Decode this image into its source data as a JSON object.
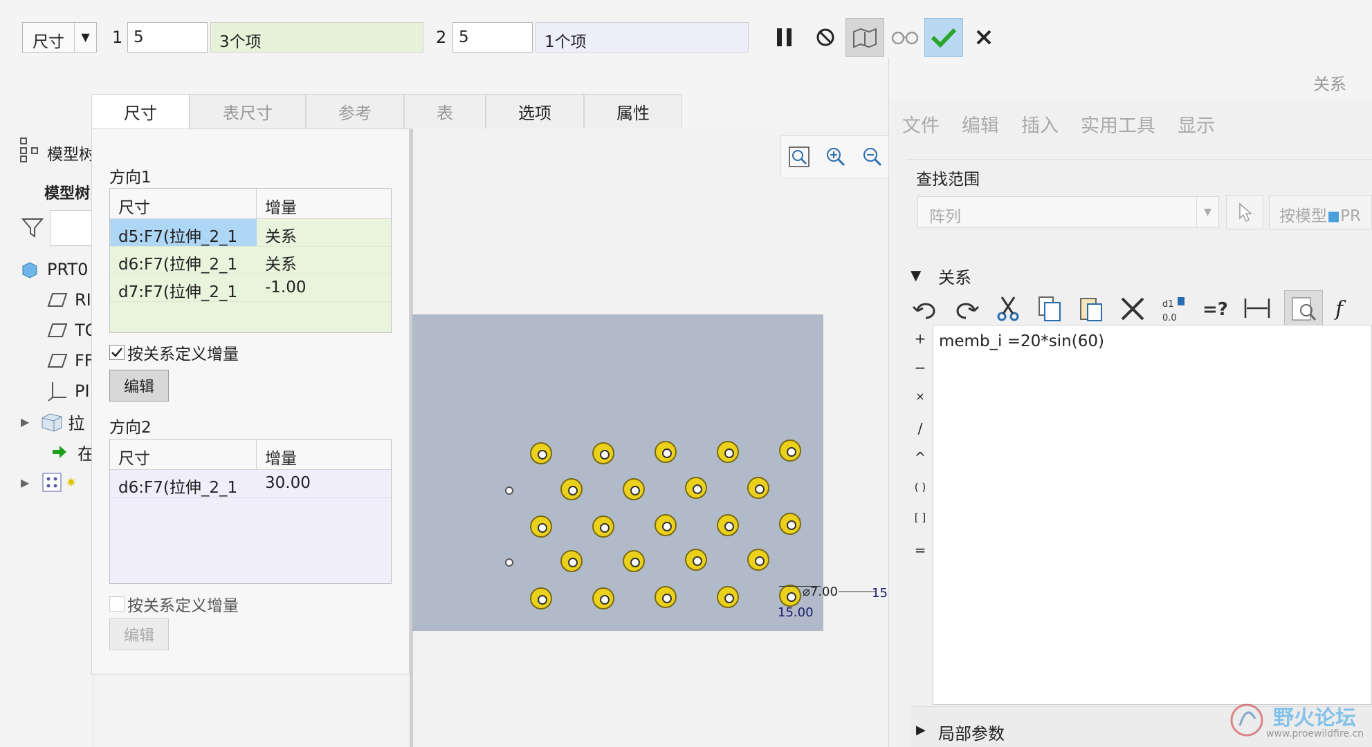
{
  "toolbar": {
    "combo_value": "尺寸",
    "dir1_label": "1",
    "dir1_count": "5",
    "dir1_items": "3个项",
    "dir2_label": "2",
    "dir2_count": "5",
    "dir2_items": "1个项",
    "buttons": [
      "pause-icon",
      "stop-icon",
      "preview-icon",
      "glasses-icon",
      "ok-icon",
      "cancel-icon"
    ]
  },
  "tabs": [
    "尺寸",
    "表尺寸",
    "参考",
    "表",
    "选项",
    "属性"
  ],
  "model_tree": {
    "title": "模型树",
    "header": "模型树",
    "items": [
      "PRT0",
      "RI",
      "TO",
      "FF",
      "PI",
      "拉",
      "在"
    ]
  },
  "direction1": {
    "title": "方向1",
    "col_dim": "尺寸",
    "col_inc": "增量",
    "rows": [
      {
        "dim": "d5:F7(拉伸_2_1",
        "inc": "关系"
      },
      {
        "dim": "d6:F7(拉伸_2_1",
        "inc": "关系"
      },
      {
        "dim": "d7:F7(拉伸_2_1",
        "inc": "-1.00"
      }
    ],
    "checkbox_label": "按关系定义增量",
    "checked": true,
    "edit_label": "编辑"
  },
  "direction2": {
    "title": "方向2",
    "col_dim": "尺寸",
    "col_inc": "增量",
    "rows": [
      {
        "dim": "d6:F7(拉伸_2_1",
        "inc": "30.00"
      }
    ],
    "checkbox_label": "按关系定义增量",
    "checked": false,
    "edit_label": "编辑"
  },
  "canvas": {
    "dim_dia": "⌀7.00",
    "dim_h": "15.00",
    "dim_side": "15"
  },
  "relations": {
    "title": "关系",
    "menu": [
      "文件",
      "编辑",
      "插入",
      "实用工具",
      "显示"
    ],
    "scope_label": "查找范围",
    "scope_value": "阵列",
    "by_model": "按模型",
    "by_model_suffix": "PR",
    "section_label": "关系",
    "code": "memb_i =20*sin(60)",
    "operators": [
      "+",
      "−",
      "×",
      "/",
      "^",
      "( )",
      "[ ]",
      "="
    ],
    "local_params": "局部参数",
    "watermark": "野火论坛",
    "watermark_url": "www.proewildfire.cn"
  }
}
